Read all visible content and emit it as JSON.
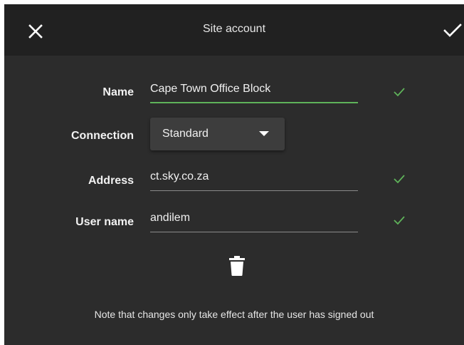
{
  "header": {
    "title": "Site account",
    "close_icon": "close-icon",
    "confirm_icon": "checkmark-icon"
  },
  "form": {
    "name": {
      "label": "Name",
      "value": "Cape Town Office Block",
      "valid": true
    },
    "connection": {
      "label": "Connection",
      "selected": "Standard"
    },
    "address": {
      "label": "Address",
      "value": "ct.sky.co.za",
      "valid": true
    },
    "username": {
      "label": "User name",
      "value": "andilem",
      "valid": true
    }
  },
  "actions": {
    "delete_icon": "trash-icon"
  },
  "note": "Note that changes only take effect after the user has signed out",
  "colors": {
    "background": "#2c2c2c",
    "header_background": "#212121",
    "accent_green": "#5fb35a",
    "text": "#f0f0f0"
  }
}
